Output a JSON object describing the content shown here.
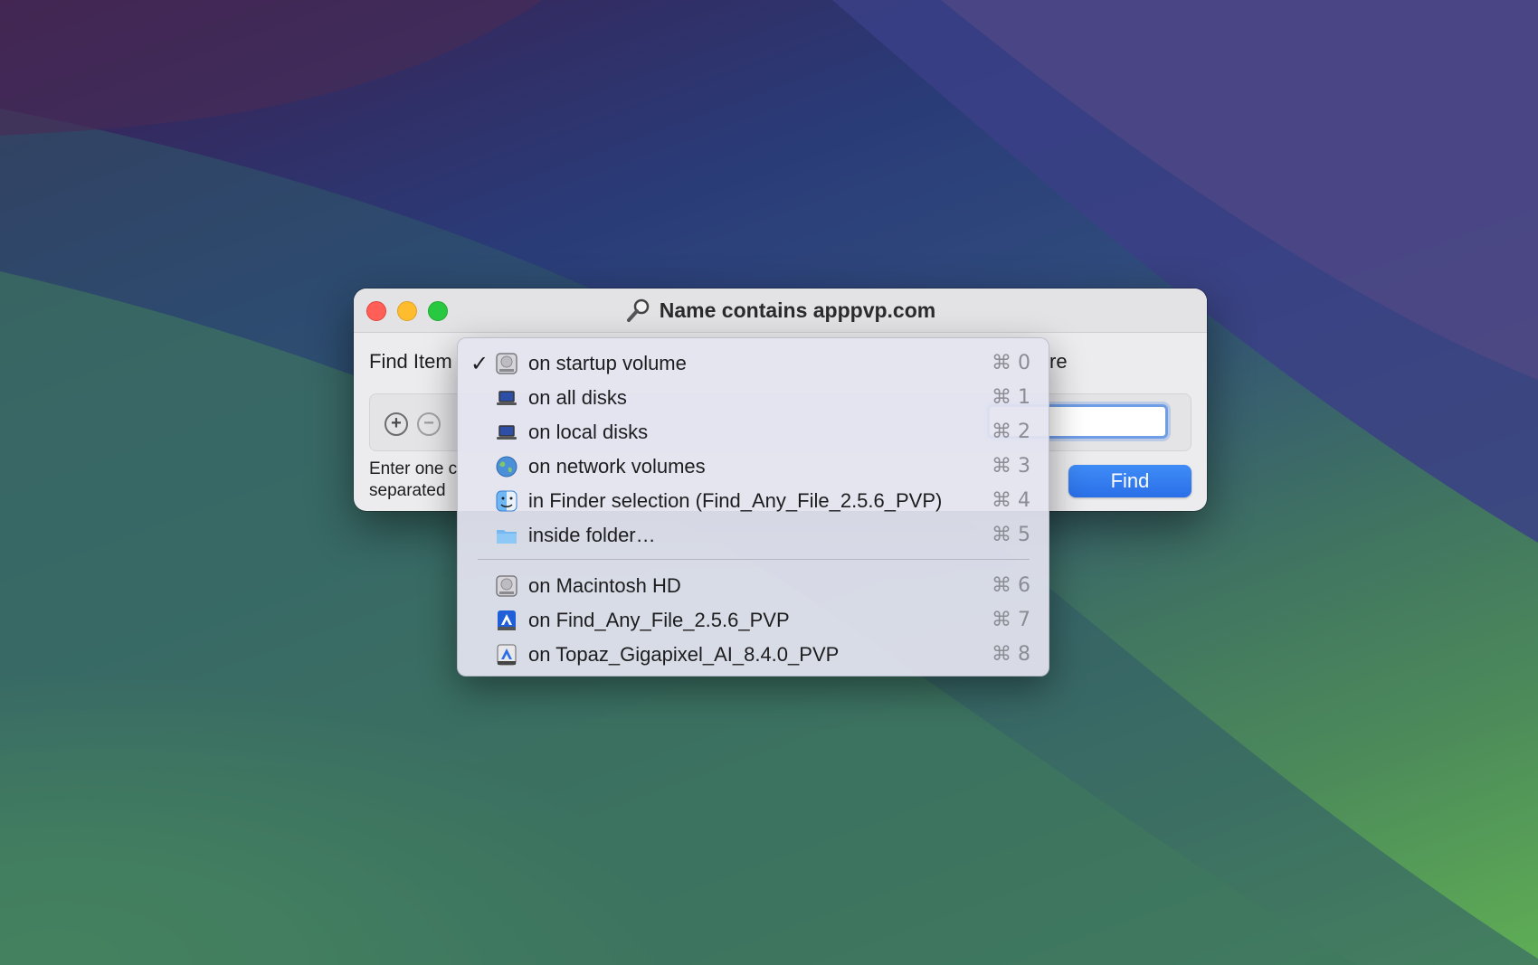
{
  "window": {
    "title": "Name contains apppvp.com",
    "find_items_label": "Find Item",
    "re_label": "re",
    "hint_line1": "Enter one c",
    "hint_line2": "separated",
    "find_button": "Find",
    "add_symbol": "+",
    "remove_symbol": "−"
  },
  "menu": {
    "items": [
      {
        "label": "on startup volume",
        "shortcut": "⌘ 0",
        "checked": true,
        "icon": "hard-drive-icon",
        "check": "✓"
      },
      {
        "label": "on all disks",
        "shortcut": "⌘ 1",
        "icon": "laptop-icon"
      },
      {
        "label": "on local disks",
        "shortcut": "⌘ 2",
        "icon": "laptop-icon"
      },
      {
        "label": "on network volumes",
        "shortcut": "⌘ 3",
        "icon": "globe-icon"
      },
      {
        "label": "in Finder selection (Find_Any_File_2.5.6_PVP)",
        "shortcut": "⌘ 4",
        "icon": "finder-icon"
      },
      {
        "label": "inside folder…",
        "shortcut": "⌘ 5",
        "icon": "folder-icon"
      },
      {
        "label": "on Macintosh HD",
        "shortcut": "⌘ 6",
        "icon": "hard-drive-icon"
      },
      {
        "label": "on Find_Any_File_2.5.6_PVP",
        "shortcut": "⌘ 7",
        "icon": "app-volume-icon"
      },
      {
        "label": "on Topaz_Gigapixel_AI_8.4.0_PVP",
        "shortcut": "⌘ 8",
        "icon": "disk-image-icon"
      }
    ]
  },
  "colors": {
    "accent": "#2a6fe8",
    "close": "#ff5f57",
    "minimize": "#febc2e",
    "zoom": "#28c840"
  }
}
